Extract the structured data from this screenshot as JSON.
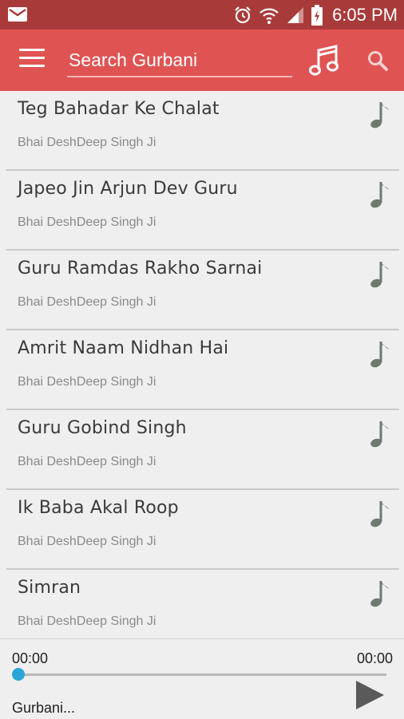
{
  "status_bar": {
    "time": "6:05 PM",
    "icons": [
      "mail-icon",
      "alarm-icon",
      "wifi-icon",
      "signal-icon",
      "battery-icon"
    ]
  },
  "app_bar": {
    "menu_icon": "menu-icon",
    "search_placeholder": "Search Gurbani",
    "music_icon": "music-notes-icon",
    "search_icon": "search-icon",
    "color": "#e05353"
  },
  "list": {
    "items": [
      {
        "title": "Teg Bahadar Ke Chalat",
        "artist": "Bhai DeshDeep Singh Ji"
      },
      {
        "title": "Japeo Jin Arjun Dev Guru",
        "artist": "Bhai DeshDeep Singh Ji"
      },
      {
        "title": "Guru Ramdas Rakho Sarnai",
        "artist": "Bhai DeshDeep Singh Ji"
      },
      {
        "title": "Amrit Naam Nidhan Hai",
        "artist": "Bhai DeshDeep Singh Ji"
      },
      {
        "title": "Guru Gobind Singh",
        "artist": "Bhai DeshDeep Singh Ji"
      },
      {
        "title": "Ik Baba Akal Roop",
        "artist": "Bhai DeshDeep Singh Ji"
      },
      {
        "title": "Simran",
        "artist": "Bhai DeshDeep Singh Ji"
      }
    ]
  },
  "player": {
    "elapsed": "00:00",
    "duration": "00:00",
    "now_playing": "Gurbani...",
    "progress_fraction": 0,
    "accent": "#2aa6d6"
  }
}
